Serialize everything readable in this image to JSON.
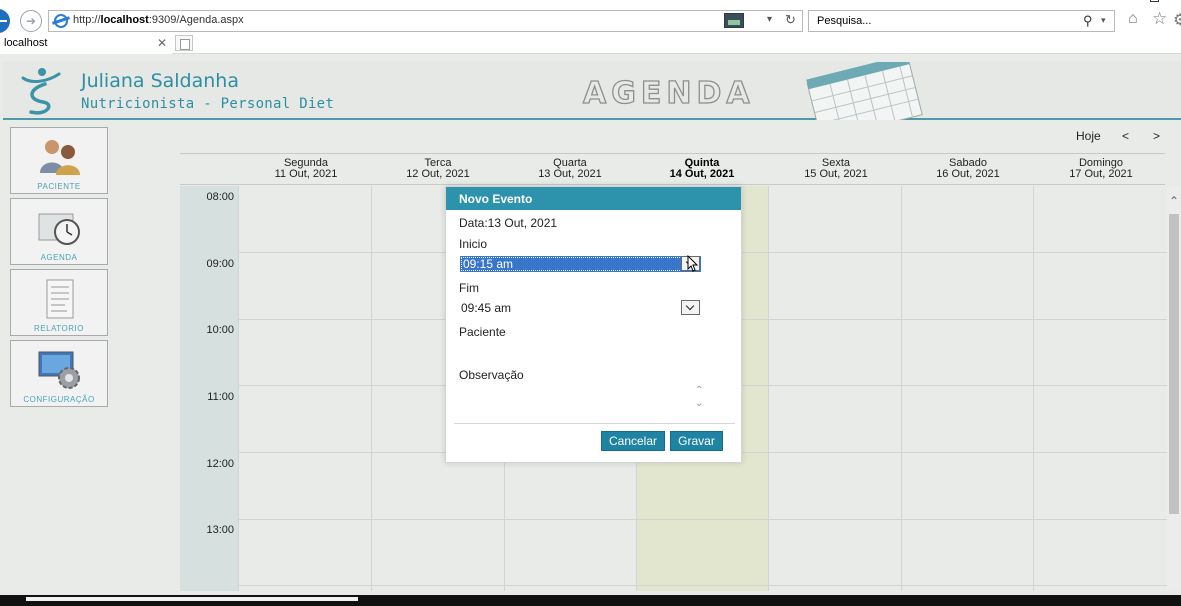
{
  "browser": {
    "url_prefix": "http://",
    "url_host": "localhost",
    "url_rest": ":9309/Agenda.aspx",
    "search_placeholder": "Pesquisa...",
    "tab_title": "localhost"
  },
  "header": {
    "name": "Juliana Saldanha",
    "subtitle": "Nutricionista - Personal Diet",
    "section": "AGENDA"
  },
  "menu": [
    {
      "label": "PACIENTE",
      "icon": "patient-icon"
    },
    {
      "label": "AGENDA",
      "icon": "clock-icon"
    },
    {
      "label": "RELATORIO",
      "icon": "report-icon"
    },
    {
      "label": "CONFIGURAÇÃO",
      "icon": "settings-icon"
    }
  ],
  "calendar": {
    "today_label": "Hoje",
    "prev_label": "<",
    "next_label": ">",
    "days": [
      {
        "name": "Segunda",
        "date": "11 Out, 2021"
      },
      {
        "name": "Terca",
        "date": "12 Out, 2021"
      },
      {
        "name": "Quarta",
        "date": "13 Out, 2021"
      },
      {
        "name": "Quinta",
        "date": "14 Out, 2021"
      },
      {
        "name": "Sexta",
        "date": "15 Out, 2021"
      },
      {
        "name": "Sabado",
        "date": "16 Out, 2021"
      },
      {
        "name": "Domingo",
        "date": "17 Out, 2021"
      }
    ],
    "today_index": 3,
    "hours": [
      "08:00",
      "09:00",
      "10:00",
      "11:00",
      "12:00",
      "13:00"
    ]
  },
  "modal": {
    "title": "Novo Evento",
    "date_text": "Data:13 Out, 2021",
    "start_label": "Inicio",
    "start_value": "09:15 am",
    "end_label": "Fim",
    "end_value": "09:45 am",
    "patient_label": "Paciente",
    "notes_label": "Observação",
    "cancel_label": "Cancelar",
    "save_label": "Gravar"
  },
  "colors": {
    "accent": "#2d93ad",
    "header_line": "#4e9aa8",
    "today_column": "#e3e6cf",
    "selected": "#3876c9"
  }
}
